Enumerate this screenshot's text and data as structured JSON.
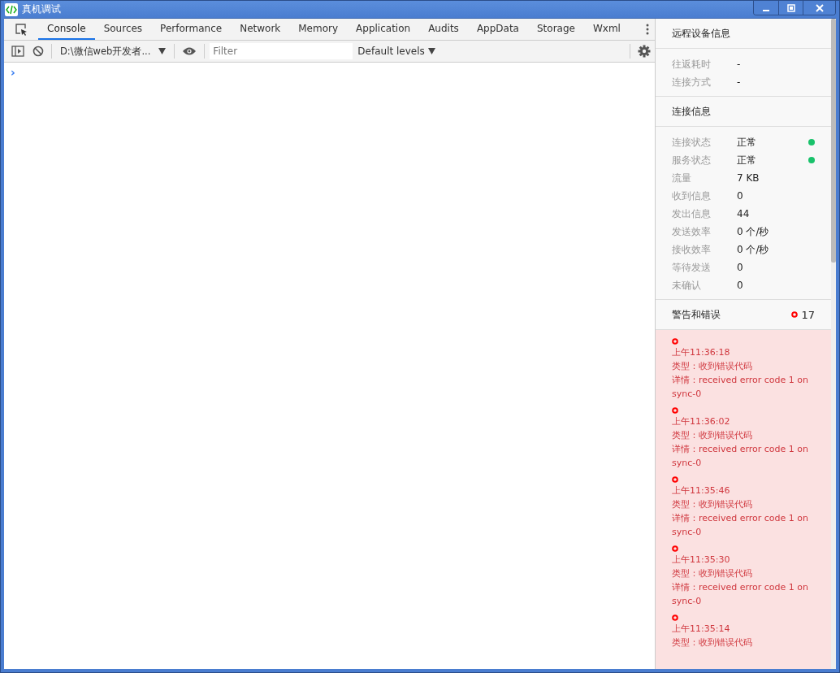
{
  "window": {
    "title": "真机调试"
  },
  "tabs": [
    {
      "label": "Console",
      "selected": true
    },
    {
      "label": "Sources",
      "selected": false
    },
    {
      "label": "Performance",
      "selected": false
    },
    {
      "label": "Network",
      "selected": false
    },
    {
      "label": "Memory",
      "selected": false
    },
    {
      "label": "Application",
      "selected": false
    },
    {
      "label": "Audits",
      "selected": false
    },
    {
      "label": "AppData",
      "selected": false
    },
    {
      "label": "Storage",
      "selected": false
    },
    {
      "label": "Wxml",
      "selected": false
    }
  ],
  "console_toolbar": {
    "context": "D:\\微信web开发者...",
    "filter": {
      "placeholder": "Filter"
    },
    "levels": "Default levels"
  },
  "console": {
    "prompt": "›"
  },
  "sidebar": {
    "device": {
      "title": "远程设备信息",
      "rows": [
        {
          "label": "往返耗时",
          "value": "-"
        },
        {
          "label": "连接方式",
          "value": "-"
        }
      ]
    },
    "connection": {
      "title": "连接信息",
      "rows": [
        {
          "label": "连接状态",
          "value": "正常",
          "color": "#19c26b"
        },
        {
          "label": "服务状态",
          "value": "正常",
          "color": "#19c26b"
        },
        {
          "label": "流量",
          "value": "7 KB"
        },
        {
          "label": "收到信息",
          "value": "0"
        },
        {
          "label": "发出信息",
          "value": "44"
        },
        {
          "label": "发送效率",
          "value": "0 个/秒"
        },
        {
          "label": "接收效率",
          "value": "0 个/秒"
        },
        {
          "label": "等待发送",
          "value": "0"
        },
        {
          "label": "未确认",
          "value": "0"
        }
      ]
    },
    "errors": {
      "title": "警告和错误",
      "count": "17",
      "entries": [
        {
          "time": "上午11:36:18",
          "type": "类型：收到错误代码",
          "detail": "详情：received error code 1 on sync-0"
        },
        {
          "time": "上午11:36:02",
          "type": "类型：收到错误代码",
          "detail": "详情：received error code 1 on sync-0"
        },
        {
          "time": "上午11:35:46",
          "type": "类型：收到错误代码",
          "detail": "详情：received error code 1 on sync-0"
        },
        {
          "time": "上午11:35:30",
          "type": "类型：收到错误代码",
          "detail": "详情：received error code 1 on sync-0"
        },
        {
          "time": "上午11:35:14",
          "type": "类型：收到错误代码"
        }
      ]
    }
  }
}
